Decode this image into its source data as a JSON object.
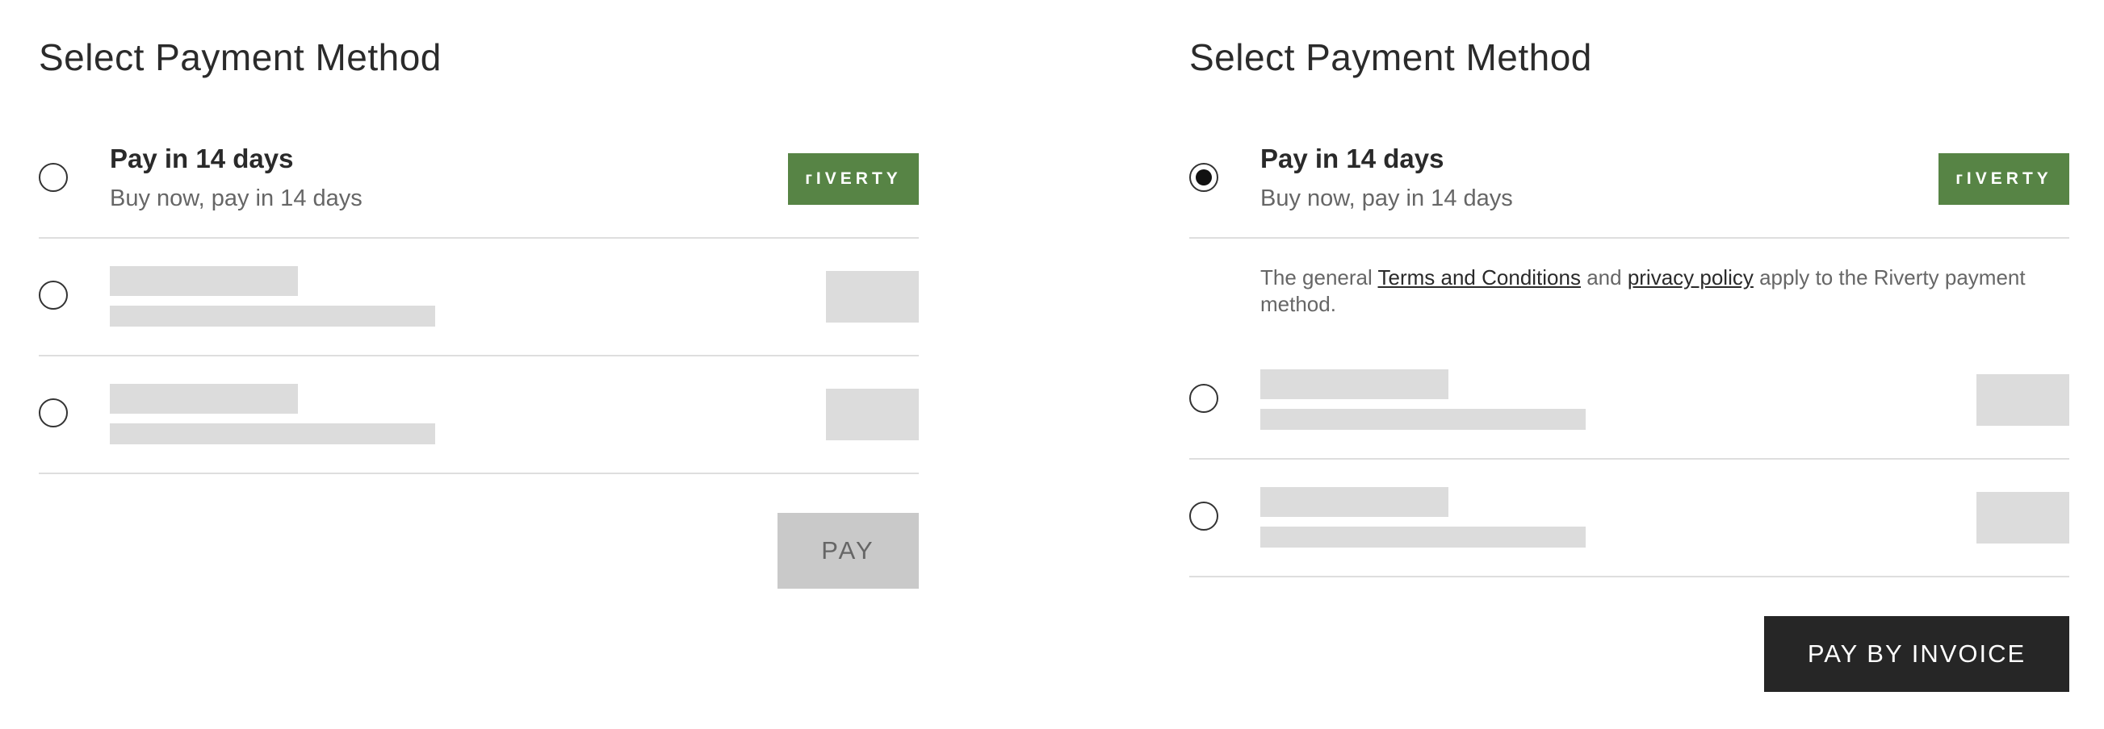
{
  "left_panel": {
    "title": "Select Payment Method",
    "selected_option": null,
    "options": [
      {
        "title": "Pay in 14 days",
        "subtitle": "Buy now, pay in 14 days",
        "logo_text": "ᴦIVERTY"
      }
    ],
    "pay_button": {
      "label": "PAY",
      "state": "disabled"
    }
  },
  "right_panel": {
    "title": "Select Payment Method",
    "selected_option": "Pay in 14 days",
    "options": [
      {
        "title": "Pay in 14 days",
        "subtitle": "Buy now, pay in 14 days",
        "logo_text": "ᴦIVERTY"
      }
    ],
    "terms": {
      "prefix": "The general ",
      "terms_link": "Terms and Conditions",
      "middle": " and ",
      "privacy_link": "privacy policy",
      "suffix": " apply to the Riverty payment method."
    },
    "pay_button": {
      "label": "PAY BY INVOICE",
      "state": "enabled"
    }
  },
  "colors": {
    "brand_green": "#578445",
    "skeleton": "#dcdcdc",
    "disabled_button": "#c9c9c9",
    "primary_button": "#262626",
    "divider": "#dedede"
  },
  "icons": {
    "radio_unchecked": "radio-unchecked-icon",
    "radio_checked": "radio-checked-icon"
  }
}
